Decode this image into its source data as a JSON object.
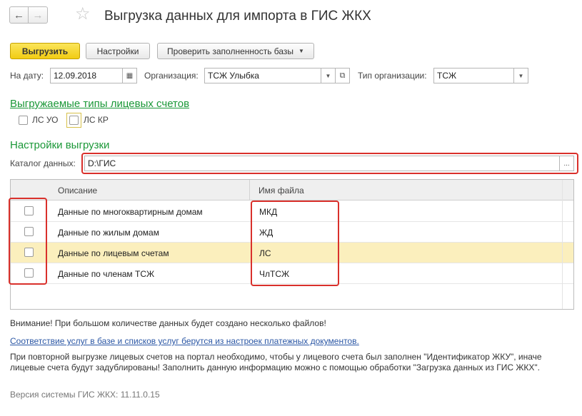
{
  "window": {
    "title": "Выгрузка данных для импорта в ГИС ЖКХ",
    "back_icon": "←",
    "forward_icon": "→",
    "star_icon": "☆"
  },
  "toolbar": {
    "export_label": "Выгрузить",
    "settings_label": "Настройки",
    "check_db_label": "Проверить заполненность базы",
    "dropdown_caret": "▼"
  },
  "filters": {
    "date_label": "На дату:",
    "date_value": "12.09.2018",
    "org_label": "Организация:",
    "org_value": "ТСЖ Улыбка",
    "org_type_label": "Тип организации:",
    "org_type_value": "ТСЖ",
    "calendar_icon": "▦",
    "dropdown_icon": "▼",
    "open_icon": "⧉"
  },
  "account_types": {
    "title": "Выгружаемые типы лицевых счетов",
    "items": [
      {
        "label": "ЛС УО",
        "checked": false
      },
      {
        "label": "ЛС КР",
        "checked": false
      }
    ]
  },
  "export_settings": {
    "title": "Настройки выгрузки",
    "catalog_label": "Каталог данных:",
    "catalog_value": "D:\\ГИС",
    "browse_label": "..."
  },
  "table": {
    "columns": [
      "Описание",
      "Имя файла"
    ],
    "rows": [
      {
        "description": "Данные по многоквартирным домам",
        "file": "МКД",
        "checked": false
      },
      {
        "description": "Данные по жилым домам",
        "file": "ЖД",
        "checked": false
      },
      {
        "description": "Данные по лицевым счетам",
        "file": "ЛС",
        "checked": false
      },
      {
        "description": "Данные по членам ТСЖ",
        "file": "ЧлТСЖ",
        "checked": false
      }
    ]
  },
  "notes": {
    "warning": "Внимание! При большом количестве данных будет создано несколько файлов!",
    "services_link": "Соответствие услуг в базе и списков услуг берутся из настроек платежных документов.",
    "info": "При повторной выгрузке лицевых счетов на портал необходимо, чтобы у лицевого счета был заполнен \"Идентификатор ЖКУ\", иначе лицевые счета будут задублированы! Заполнить данную информацию можно с помощью обработки \"Загрузка данных из ГИС ЖКХ\".",
    "version": "Версия системы ГИС ЖКХ: 11.11.0.15"
  },
  "colors": {
    "primary_button": "#f4d22b",
    "section_title": "#1b9838",
    "selected_row": "#fbefbd",
    "annotation": "#d9302b",
    "link": "#2b57a5"
  }
}
